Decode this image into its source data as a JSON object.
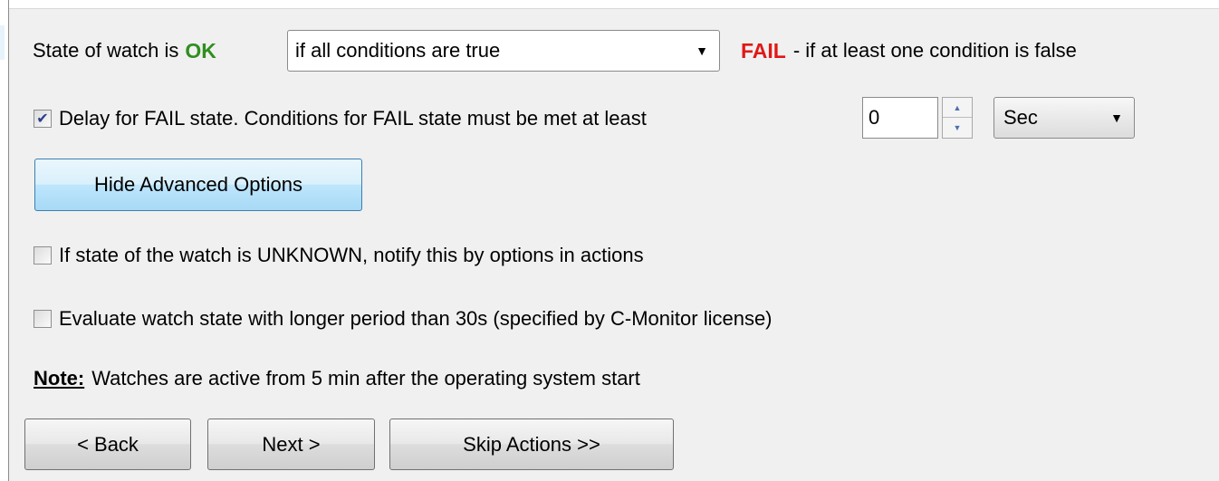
{
  "state_row": {
    "prefix": "State of watch is",
    "ok_label": "OK",
    "condition_value": "if all conditions are true",
    "fail_label": "FAIL",
    "fail_suffix": "- if at least one condition is false"
  },
  "delay_row": {
    "checked": true,
    "label": "Delay for FAIL state. Conditions for FAIL state must be met at least",
    "value": "0",
    "unit": "Sec"
  },
  "advanced_button": "Hide Advanced Options",
  "unknown_option": {
    "checked": false,
    "label": "If state of the watch is UNKNOWN, notify this by options in actions"
  },
  "period_option": {
    "checked": false,
    "label": "Evaluate watch state with longer period than 30s (specified by C-Monitor license)"
  },
  "note": {
    "label": "Note:",
    "text": "Watches are active from 5 min after the operating system start"
  },
  "nav": {
    "back": "< Back",
    "next": "Next >",
    "skip": "Skip Actions >>"
  },
  "colors": {
    "ok": "#2f8f1f",
    "fail": "#e01818",
    "active_button": "#bee6fd"
  },
  "icons": {
    "checkmark": "check-icon",
    "dropdown": "chevron-down-icon",
    "spin_up": "arrow-up-icon",
    "spin_down": "arrow-down-icon"
  }
}
